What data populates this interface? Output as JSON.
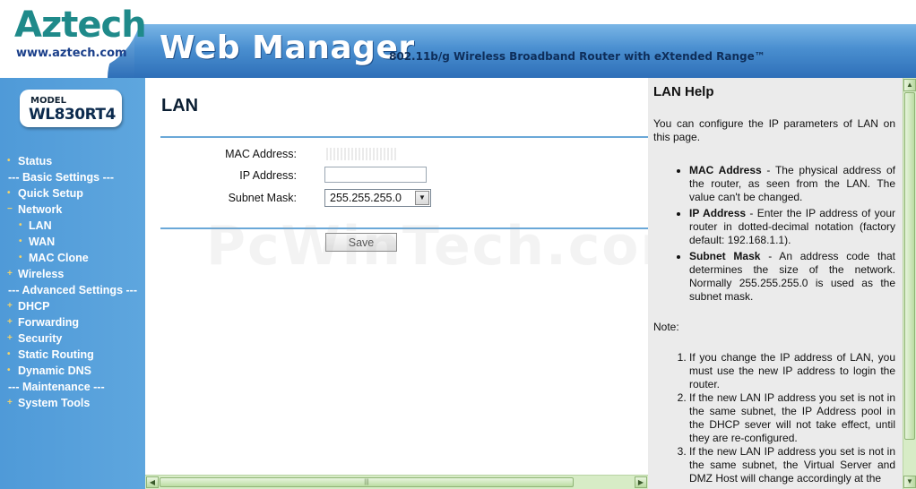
{
  "header": {
    "logo": "Aztech",
    "logo_url": "www.aztech.com",
    "title": "Web Manager",
    "subtitle": "802.11b/g Wireless Broadband Router with eXtended Range™"
  },
  "sidebar": {
    "model_label": "MODEL",
    "model_name": "WL830RT4",
    "items": [
      {
        "label": "Status",
        "kind": "top"
      },
      {
        "label": "--- Basic Settings ---",
        "kind": "sep"
      },
      {
        "label": "Quick Setup",
        "kind": "top"
      },
      {
        "label": "Network",
        "kind": "top-open"
      },
      {
        "label": "LAN",
        "kind": "sub",
        "active": true
      },
      {
        "label": "WAN",
        "kind": "sub"
      },
      {
        "label": "MAC Clone",
        "kind": "sub"
      },
      {
        "label": "Wireless",
        "kind": "top-plus"
      },
      {
        "label": "--- Advanced Settings ---",
        "kind": "sep"
      },
      {
        "label": "DHCP",
        "kind": "top-plus"
      },
      {
        "label": "Forwarding",
        "kind": "top-plus"
      },
      {
        "label": "Security",
        "kind": "top-plus"
      },
      {
        "label": "Static Routing",
        "kind": "top"
      },
      {
        "label": "Dynamic DNS",
        "kind": "top"
      },
      {
        "label": "--- Maintenance ---",
        "kind": "sep"
      },
      {
        "label": "System Tools",
        "kind": "top-plus"
      }
    ]
  },
  "main": {
    "title": "LAN",
    "mac_label": "MAC Address:",
    "ip_label": "IP Address:",
    "mask_label": "Subnet Mask:",
    "mask_value": "255.255.255.0",
    "save_label": "Save",
    "watermark": "PcWinTech.com"
  },
  "help": {
    "title": "LAN Help",
    "intro": "You can configure the IP parameters of LAN on this page.",
    "items": [
      {
        "term": "MAC Address",
        "text": " - The physical address of the router, as seen from the LAN. The value can't be changed."
      },
      {
        "term": "IP Address",
        "text": " - Enter the IP address of your router in dotted-decimal notation (factory default: 192.168.1.1)."
      },
      {
        "term": "Subnet Mask",
        "text": " - An address code that determines the size of the network. Normally 255.255.255.0 is used as the subnet mask."
      }
    ],
    "note_label": "Note:",
    "notes": [
      "If you change the IP address of LAN, you must use the new IP address to login the router.",
      "If the new LAN IP address you set is not in the same subnet, the IP Address pool in the DHCP sever will not take effect, until they are re-configured.",
      "If the new LAN IP address you set is not in the same subnet, the Virtual Server and DMZ Host will change accordingly at the"
    ]
  }
}
